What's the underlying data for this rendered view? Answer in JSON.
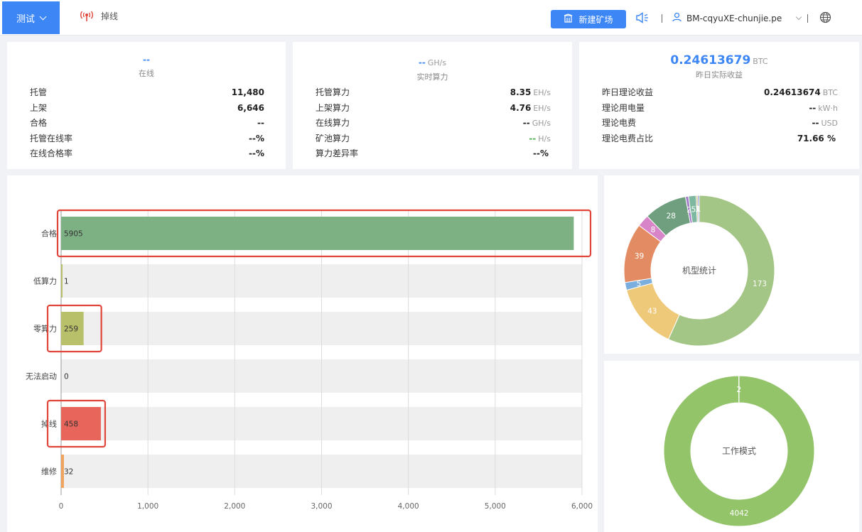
{
  "header": {
    "project_label": "测试",
    "offline_label": "掉线",
    "new_site_label": "新建矿场",
    "user_name": "BM-cqyuXE-chunjie.pe"
  },
  "card1": {
    "head_value": "--",
    "head_label": "在线",
    "rows": [
      {
        "label": "托管",
        "value": "11,480"
      },
      {
        "label": "上架",
        "value": "6,646"
      },
      {
        "label": "合格",
        "value": "--"
      },
      {
        "label": "托管在线率",
        "value": "--%"
      },
      {
        "label": "在线合格率",
        "value": "--%"
      }
    ]
  },
  "card2": {
    "head_value": "--",
    "head_unit": "GH/s",
    "head_label": "实时算力",
    "rows": [
      {
        "label": "托管算力",
        "value": "8.35",
        "unit": "EH/s"
      },
      {
        "label": "上架算力",
        "value": "4.76",
        "unit": "EH/s"
      },
      {
        "label": "在线算力",
        "value": "--",
        "unit": "GH/s"
      },
      {
        "label": "矿池算力",
        "value": "--",
        "unit": "H/s"
      },
      {
        "label": "算力差异率",
        "value": "--%",
        "unit": ""
      }
    ]
  },
  "card3": {
    "head_value": "0.24613679",
    "head_unit": "BTC",
    "head_label": "昨日实际收益",
    "rows": [
      {
        "label": "昨日理论收益",
        "value": "0.24613674",
        "unit": "BTC"
      },
      {
        "label": "理论用电量",
        "value": "--",
        "unit": "kW·h"
      },
      {
        "label": "理论电费",
        "value": "--",
        "unit": "USD"
      },
      {
        "label": "理论电费占比",
        "value": "71.66 %",
        "unit": ""
      }
    ]
  },
  "colors": {
    "accent": "#3c86f5",
    "green_bar": "#7db184",
    "olive_bar": "#b8c06a",
    "red_bar": "#e8655b",
    "orange_bar": "#f0a35c",
    "highlight": "#e0453a"
  },
  "chart_data": [
    {
      "type": "bar",
      "orientation": "horizontal",
      "categories": [
        "合格",
        "低算力",
        "零算力",
        "无法启动",
        "掉线",
        "维修"
      ],
      "values": [
        5905,
        1,
        259,
        0,
        458,
        32
      ],
      "xlim": [
        0,
        6000
      ],
      "xticks": [
        "0",
        "1,000",
        "2,000",
        "3,000",
        "4,000",
        "5,000",
        "6,000"
      ],
      "grid": true
    },
    {
      "type": "pie",
      "center_label": "机型统计",
      "values": [
        173,
        43,
        5,
        39,
        8,
        28,
        2,
        5,
        1,
        1
      ],
      "labels": [
        "173",
        "43",
        "5",
        "39",
        "8",
        "28",
        "2",
        "5",
        "1",
        "1"
      ],
      "colors": [
        "#a3c585",
        "#efc97a",
        "#7aaede",
        "#e38b62",
        "#d884c8",
        "#6f9f7e",
        "#a37cc9",
        "#7fb8a0",
        "#c5b06a",
        "#8a8fd0"
      ]
    },
    {
      "type": "pie",
      "center_label": "工作模式",
      "values": [
        4042,
        2
      ],
      "labels": [
        "4042",
        "2"
      ],
      "colors": [
        "#93c46a",
        "#d6e8c2"
      ]
    }
  ]
}
